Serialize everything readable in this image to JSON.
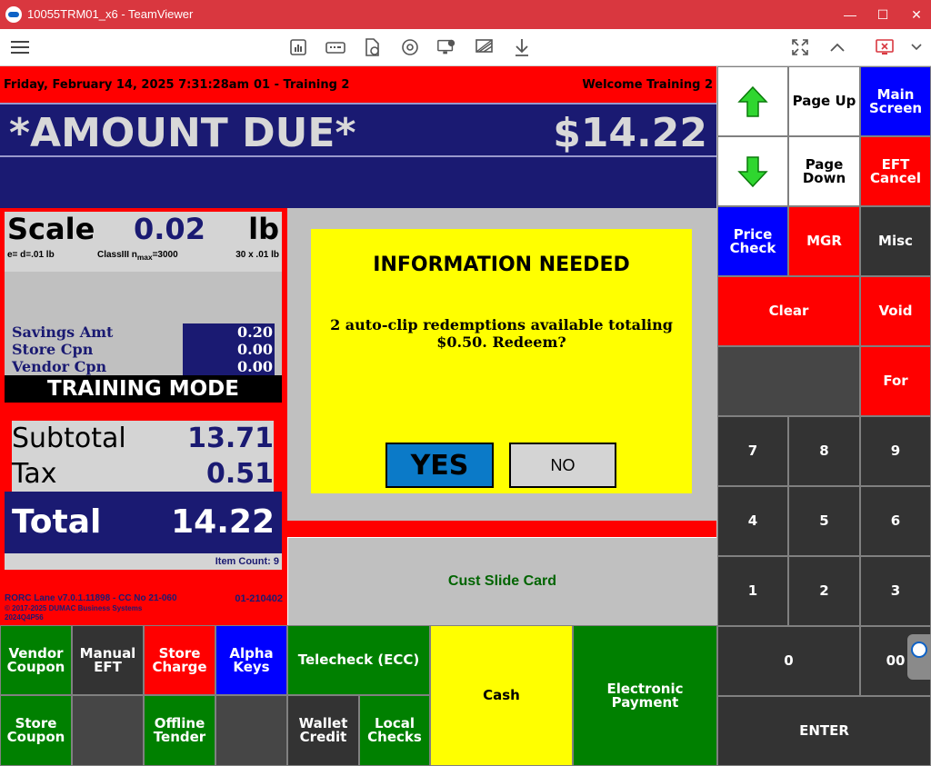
{
  "window": {
    "title": "10055TRM01_x6 - TeamViewer",
    "controls": [
      "—",
      "☐",
      "✕"
    ]
  },
  "toolbar": {
    "icons": [
      "menu-icon",
      "dashboard-icon",
      "keyboard-icon",
      "file-transfer-icon",
      "refresh-session-icon",
      "remote-screen-icon",
      "disable-view-icon",
      "download-icon",
      "fullscreen-icon",
      "collapse-icon",
      "end-session-icon",
      "chevron-down-icon"
    ]
  },
  "header": {
    "date": "Friday, February 14, 2025 7:31:28am",
    "lane": "01 - Training 2",
    "welcome": "Welcome Training 2"
  },
  "amount_due": {
    "label": "*AMOUNT DUE*",
    "value": "$14.22"
  },
  "scale": {
    "label": "Scale",
    "value": "0.02",
    "unit": "lb",
    "spec_left": "e= d=.01 lb",
    "spec_mid_prefix": "ClassIII n",
    "spec_mid_sub": "max",
    "spec_mid_suffix": "=3000",
    "spec_right": "30 x .01 lb"
  },
  "savings": [
    {
      "label": "Savings Amt",
      "value": "0.20"
    },
    {
      "label": "Store Cpn",
      "value": "0.00"
    },
    {
      "label": "Vendor Cpn",
      "value": "0.00"
    }
  ],
  "training_mode": "TRAINING MODE",
  "totals": {
    "subtotal_label": "Subtotal",
    "subtotal": "13.71",
    "tax_label": "Tax",
    "tax": "0.51",
    "total_label": "Total",
    "total": "14.22",
    "item_count": "Item Count: 9"
  },
  "footer": {
    "version": "RORC Lane v7.0.1.11898 - CC No 21-060",
    "version_id": "01-210402",
    "copyright": "© 2017-2025 DUMAC Business Systems",
    "build": "2024Q4P56"
  },
  "dialog": {
    "title": "INFORMATION NEEDED",
    "message_line1": "2 auto-clip redemptions available totaling",
    "message_line2": "$0.50. Redeem?",
    "yes": "YES",
    "no": "NO"
  },
  "center": {
    "cust_slide_card": "Cust Slide Card"
  },
  "keys": {
    "page_up": "Page Up",
    "main_screen_1": "Main",
    "main_screen_2": "Screen",
    "page_down_1": "Page",
    "page_down_2": "Down",
    "eft_cancel_1": "EFT",
    "eft_cancel_2": "Cancel",
    "price_check_1": "Price",
    "price_check_2": "Check",
    "mgr": "MGR",
    "misc": "Misc",
    "clear": "Clear",
    "void": "Void",
    "for": "For",
    "n7": "7",
    "n8": "8",
    "n9": "9",
    "n4": "4",
    "n5": "5",
    "n6": "6",
    "n1": "1",
    "n2": "2",
    "n3": "3",
    "n0": "0",
    "n00": "00",
    "enter": "ENTER",
    "vendor_coupon_1": "Vendor",
    "vendor_coupon_2": "Coupon",
    "manual_eft_1": "Manual",
    "manual_eft_2": "EFT",
    "store_charge_1": "Store",
    "store_charge_2": "Charge",
    "alpha_keys_1": "Alpha",
    "alpha_keys_2": "Keys",
    "telecheck": "Telecheck (ECC)",
    "cash": "Cash",
    "electronic_payment": "Electronic Payment",
    "store_coupon_1": "Store",
    "store_coupon_2": "Coupon",
    "offline_tender_1": "Offline",
    "offline_tender_2": "Tender",
    "wallet_credit_1": "Wallet",
    "wallet_credit_2": "Credit",
    "local_checks_1": "Local",
    "local_checks_2": "Checks"
  },
  "colors": {
    "pos_red": "#ff0000",
    "pos_navy": "#1a1a72",
    "pos_blue": "#0000ff",
    "pos_green": "#008000",
    "dialog_yellow": "#ffff00",
    "titlebar": "#d9373f"
  }
}
